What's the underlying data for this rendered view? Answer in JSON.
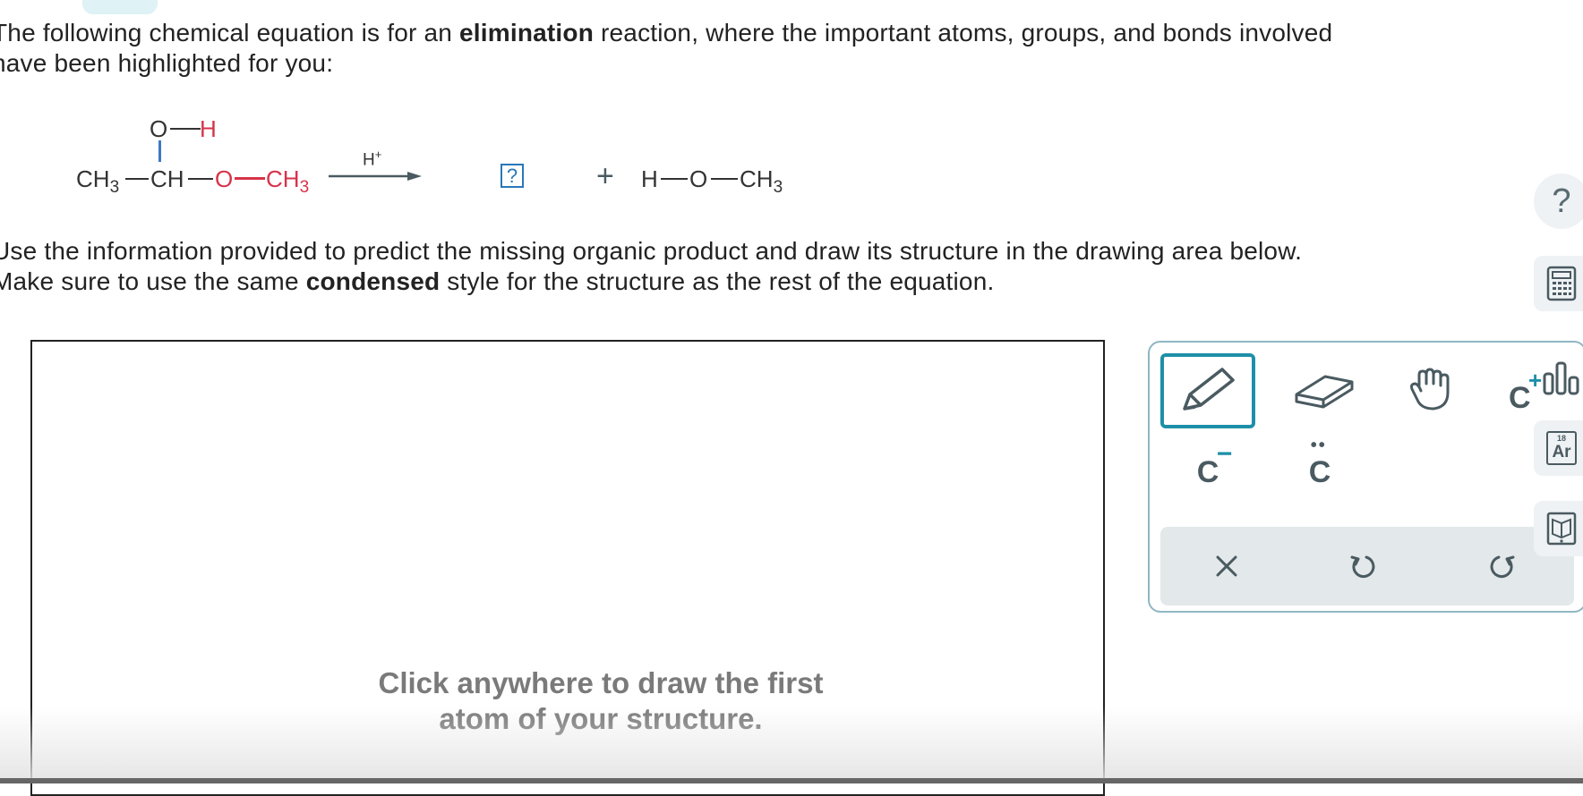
{
  "intro": {
    "pre": "The following chemical equation is for an ",
    "bold": "elimination",
    "post1": " reaction, where the important atoms, groups, and bonds involved",
    "line2": "have been highlighted for you:"
  },
  "equation": {
    "reactant": {
      "top_o": "O",
      "top_h": "H",
      "ch3": "CH",
      "ch3_sub": "3",
      "ch": "CH",
      "o": "O",
      "ch3b": "CH",
      "ch3b_sub": "3"
    },
    "catalyst": "H",
    "catalyst_sup": "+",
    "missing_symbol": "?",
    "plus": "+",
    "product2": {
      "h": "H",
      "o": "O",
      "ch3": "CH",
      "ch3_sub": "3"
    }
  },
  "instructions": {
    "line1": "Use the information provided to predict the missing organic product and draw its structure in the drawing area below.",
    "line2_pre": "Make sure to use the same ",
    "line2_bold": "condensed",
    "line2_post": " style for the structure as the rest of the equation."
  },
  "drawing": {
    "hint": "Click anywhere to draw the first\natom of your structure."
  },
  "toolbar": {
    "tools": [
      "pencil-icon",
      "eraser-icon",
      "hand-icon",
      "chain-icon",
      "charge-minus-icon",
      "lone-pair-icon"
    ],
    "charge_label": "C",
    "charge_sign": "−",
    "lonepair_label": "C",
    "lonepair_dots": "••",
    "chain_c": "C",
    "chain_plus": "+"
  },
  "actions": [
    "clear-icon",
    "undo-icon",
    "redo-icon"
  ],
  "side": {
    "help": "?",
    "periodic_num": "18",
    "periodic_sym": "Ar"
  },
  "colors": {
    "accent": "#1e8fa8",
    "highlight_red": "#d6334a",
    "highlight_blue": "#3c78c8"
  }
}
